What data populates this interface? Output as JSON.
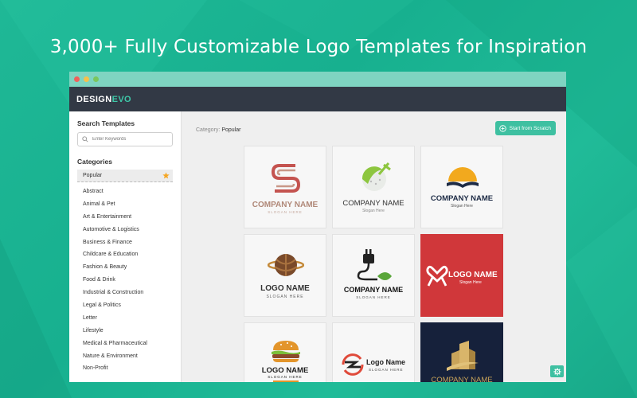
{
  "headline": "3,000+ Fully Customizable Logo Templates for Inspiration",
  "app": {
    "brand_main": "DESIGN",
    "brand_accent": "EVO",
    "accent_color": "#3ec0a1",
    "header_color": "#323945"
  },
  "window_controls": {
    "close_color": "#f0605a",
    "minimize_color": "#f7c04b",
    "maximize_color": "#7bc65d"
  },
  "sidebar": {
    "search_title": "Search Templates",
    "search_placeholder": "Enter Keywords",
    "categories_title": "Categories",
    "selected_category": "Popular",
    "categories": [
      "Abstract",
      "Animal & Pet",
      "Art & Entertainment",
      "Automotive & Logistics",
      "Business & Finance",
      "Childcare & Education",
      "Fashion & Beauty",
      "Food & Drink",
      "Industrial & Construction",
      "Legal & Politics",
      "Letter",
      "Lifestyle",
      "Medical & Pharmaceutical",
      "Nature & Environment",
      "Non-Profit"
    ]
  },
  "main": {
    "category_prefix": "Category:",
    "category_value": "Popular",
    "start_button": "Start from Scratch"
  },
  "templates": [
    {
      "name": "COMPANY NAME",
      "slogan": "SLOGAN HERE",
      "icon": "s-ribbon-icon"
    },
    {
      "name": "COMPANY NAME",
      "slogan": "Slogan Here",
      "icon": "golf-ball-icon"
    },
    {
      "name": "COMPANY NAME",
      "slogan": "Slogan Here",
      "icon": "sun-book-icon"
    },
    {
      "name": "LOGO NAME",
      "slogan": "SLOGAN HERE",
      "icon": "globe-sphere-icon"
    },
    {
      "name": "COMPANY NAME",
      "slogan": "SLOGAN HERE",
      "icon": "plug-leaf-icon"
    },
    {
      "name": "LOGO NAME",
      "slogan": "Slogan Here",
      "icon": "heart-ribbon-icon"
    },
    {
      "name": "LOGO NAME",
      "slogan": "SLOGAN HERE",
      "icon": "burger-icon"
    },
    {
      "name": "Logo Name",
      "slogan": "SLOGAN HERE",
      "icon": "lightning-circle-icon"
    },
    {
      "name": "COMPANY NAME",
      "slogan": "",
      "icon": "gold-buildings-icon"
    }
  ]
}
